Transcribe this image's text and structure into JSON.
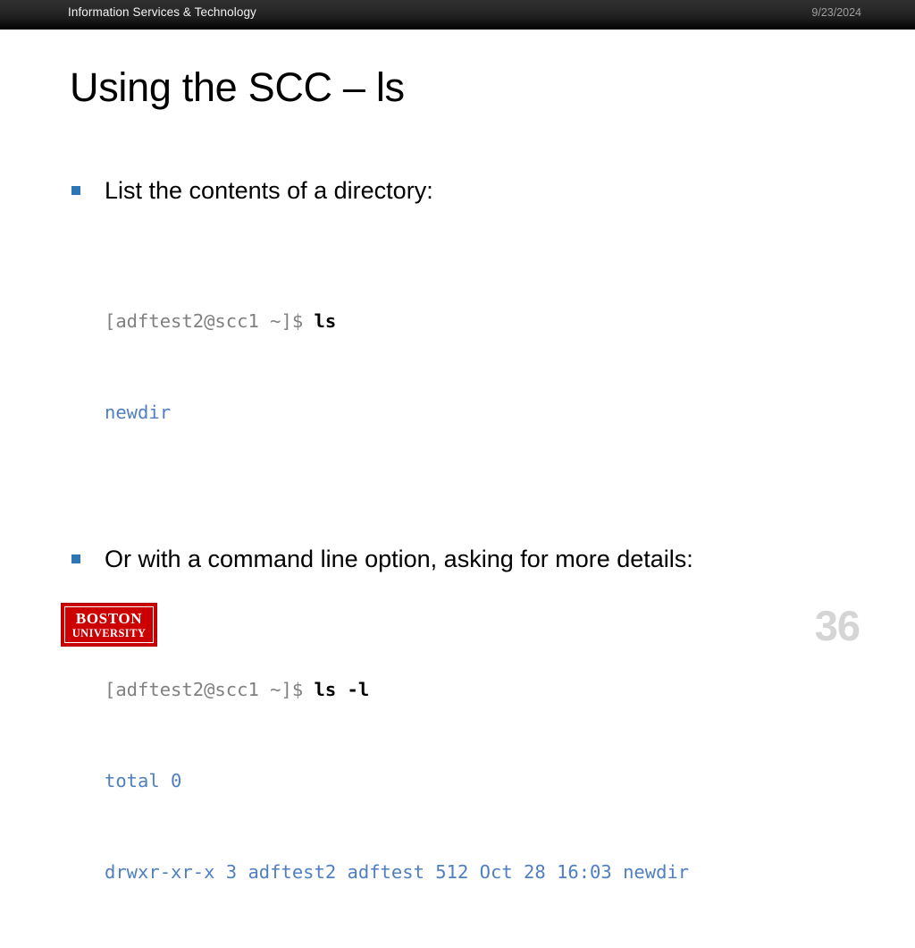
{
  "header": {
    "title": "Information Services & Technology",
    "date": "9/23/2024"
  },
  "slide": {
    "title": "Using the SCC – ls",
    "number": "36"
  },
  "content": {
    "bullet_1": {
      "text": "List the contents of a directory:",
      "marker": "square-bullet"
    },
    "code_1": {
      "prompt": "[adftest2@scc1 ~]$ ",
      "command": "ls",
      "output_line_1": "newdir"
    },
    "bullet_2": {
      "text": "Or with a command line option, asking for more details:",
      "marker": "square-bullet"
    },
    "code_2": {
      "prompt": "[adftest2@scc1 ~]$ ",
      "command": "ls -l",
      "output_line_1": "total 0",
      "output_line_2": "drwxr-xr-x 3 adftest2 adftest 512 Oct 28 16:03 newdir"
    }
  },
  "logo": {
    "line_1": "BOSTON",
    "line_2": "UNIVERSITY"
  },
  "colors": {
    "bullet_blue": "#2e75b6",
    "terminal_output_blue": "#4f7fbf",
    "terminal_prompt_gray": "#808080",
    "logo_red": "#cc0000",
    "page_number_gray": "#d5d5d5",
    "header_date_gray": "#9d9d9d"
  }
}
